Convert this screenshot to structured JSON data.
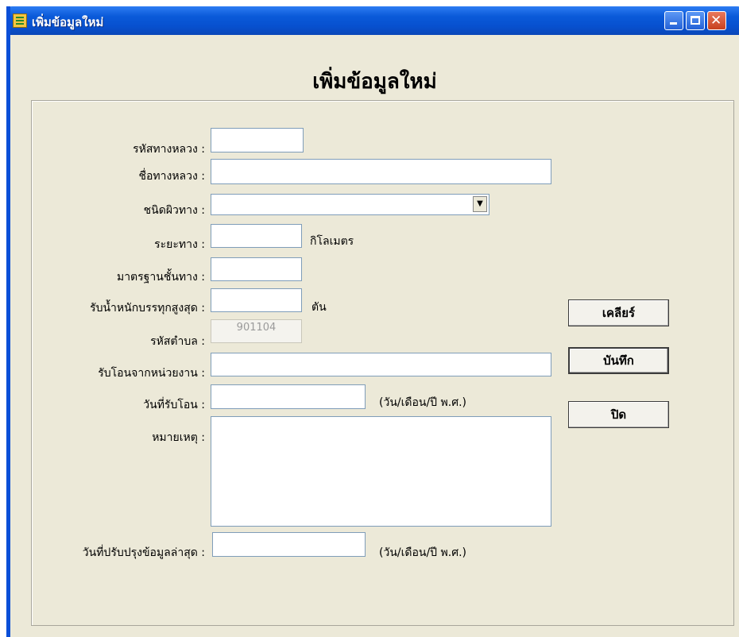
{
  "window": {
    "title": "เพิ่มข้อมูลใหม่",
    "heading": "เพิ่มข้อมูลใหม่",
    "controls": {
      "minimize": "minimize-icon",
      "maximize": "maximize-icon",
      "close": "close-icon"
    }
  },
  "form": {
    "road_code_label": "รหัสทางหลวง :",
    "road_code_value": "",
    "road_name_label": "ชื่อทางหลวง :",
    "road_name_value": "",
    "surface_type_label": "ชนิดผิวทาง :",
    "surface_type_value": "",
    "distance_label": "ระยะทาง :",
    "distance_value": "",
    "distance_unit": "กิโลเมตร",
    "road_standard_label": "มาตรฐานชั้นทาง :",
    "road_standard_value": "",
    "max_load_label": "รับน้ำหนักบรรทุกสูงสุด :",
    "max_load_value": "",
    "max_load_unit": "ตัน",
    "subdistrict_code_label": "รหัสตำบล :",
    "subdistrict_code_value": "901104",
    "transfer_from_label": "รับโอนจากหน่วยงาน :",
    "transfer_from_value": "",
    "transfer_date_label": "วันที่รับโอน :",
    "transfer_date_value": "",
    "transfer_date_hint": "(วัน/เดือน/ปี พ.ศ.)",
    "remarks_label": "หมายเหตุ :",
    "remarks_value": "",
    "last_update_label": "วันที่ปรับปรุงข้อมูลล่าสุด :",
    "last_update_value": "",
    "last_update_hint": "(วัน/เดือน/ปี พ.ศ.)"
  },
  "buttons": {
    "clear": "เคลียร์",
    "save": "บันทึก",
    "close": "ปิด"
  },
  "colors": {
    "titlebar": "#0a5ad9",
    "window_bg": "#ece9d8",
    "input_border": "#7f9db9"
  }
}
